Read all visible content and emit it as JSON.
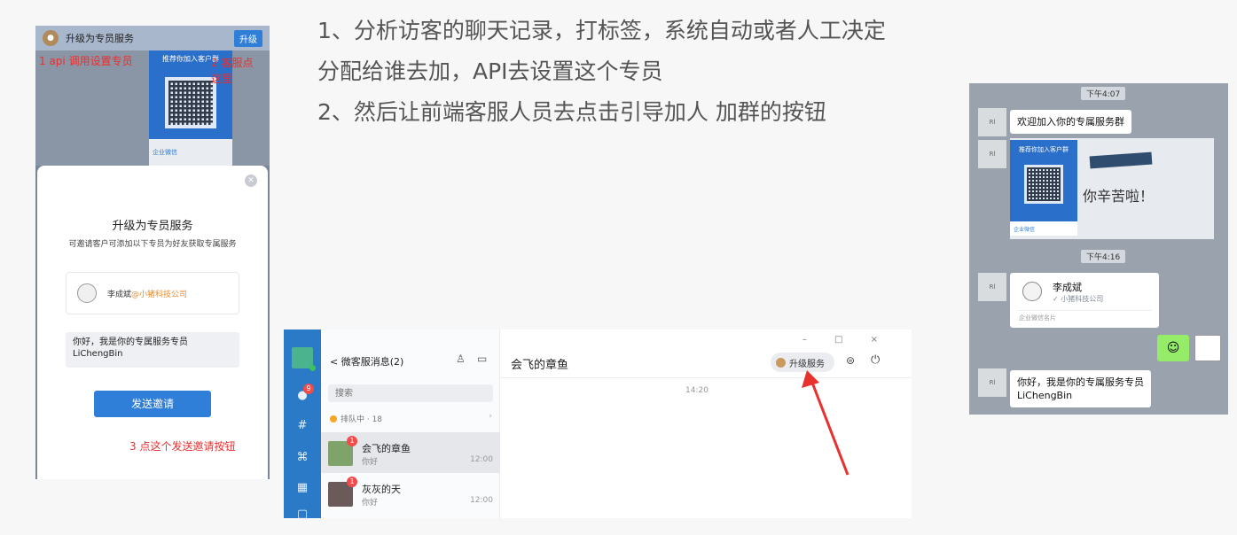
{
  "instructions": {
    "line1": "1、分析访客的聊天记录，打标签，系统自动或者人工决定",
    "line2": "分配给谁去加，API去设置这个专员",
    "line3": "2、然后让前端客服人员去点击引导加人 加群的按钮"
  },
  "mobile_popup": {
    "topbar_title": "升级为专员服务",
    "topbar_button": "升级",
    "qr_card_title": "推荐你加入客户群",
    "qr_card_footer": "企业微信",
    "annotation_1": "1 api 调用设置专员",
    "annotation_2": "2 客服点这里",
    "sheet_title": "升级为专员服务",
    "sheet_subtitle": "可邀请客户可添加以下专员为好友获取专属服务",
    "contact_name": "李成斌",
    "contact_org": "@小猪科技公司",
    "message_line1": "你好，我是你的专属服务专员",
    "message_line2": "LiChengBin",
    "send_button": "发送邀请",
    "annotation_3": "3 点这个发送邀请按钮"
  },
  "desktop": {
    "window_controls": "– □ ×",
    "back_label": "< 微客服消息(2)",
    "search_placeholder": "搜索",
    "queue_label": "排队中 · 18",
    "rail_badge": "9",
    "conversations": [
      {
        "name": "会飞的章鱼",
        "preview": "你好",
        "time": "12:00",
        "badge": "1"
      },
      {
        "name": "灰灰的天",
        "preview": "你好",
        "time": "12:00",
        "badge": "1"
      }
    ],
    "chat_title": "会飞的章鱼",
    "upgrade_button": "升级服务",
    "chat_time": "14:20"
  },
  "mobile_chat": {
    "time_1": "下午4:07",
    "welcome": "欢迎加入你的专属服务群",
    "qr_title": "推荐你加入客户群",
    "qr_footer": "企业微信",
    "handwriting": "你辛苦啦！",
    "time_2": "下午4:16",
    "card_name": "李成斌",
    "card_org": "小猪科技公司",
    "card_footer": "企业微信名片",
    "reply_line1": "你好，我是你的专属服务专员",
    "reply_line2": "LiChengBin"
  },
  "colors": {
    "accent_blue": "#2f7ed8",
    "annotation_red": "#e8302f",
    "rail_blue": "#2a7ac8"
  }
}
